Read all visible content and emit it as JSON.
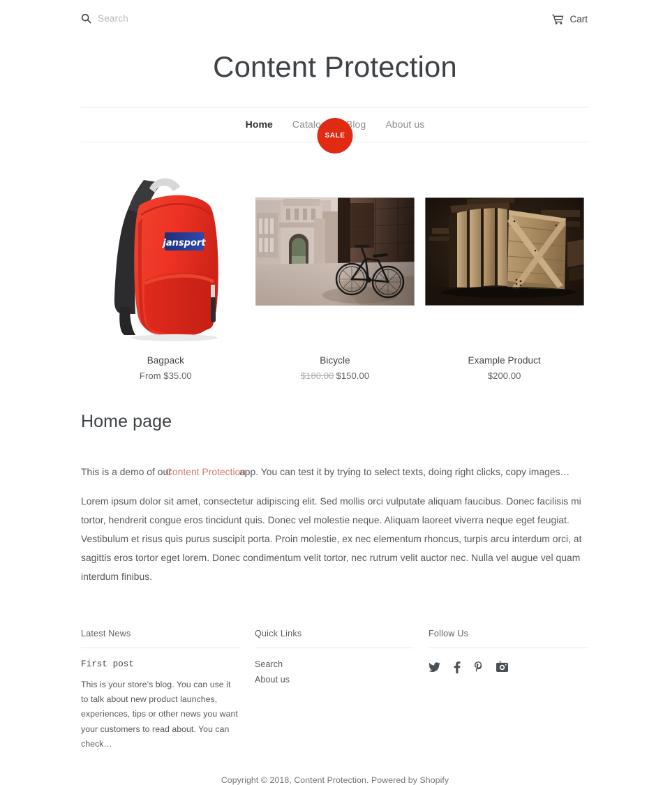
{
  "header": {
    "search": {
      "placeholder": "Search",
      "value": "",
      "icon": "search-icon"
    },
    "cart": {
      "label": "Cart",
      "icon": "cart-icon"
    },
    "site_title": "Content Protection"
  },
  "nav": {
    "items": [
      {
        "label": "Home",
        "active": true
      },
      {
        "label": "Catalog",
        "active": false
      },
      {
        "label": "Blog",
        "active": false
      },
      {
        "label": "About us",
        "active": false
      }
    ]
  },
  "products": [
    {
      "title": "Bagpack",
      "price": "From $35.00",
      "compare_price": "",
      "badge": "",
      "image": "red-jansport-backpack-on-white"
    },
    {
      "title": "Bicycle",
      "price": "$150.00",
      "compare_price": "$180.00",
      "badge": "SALE",
      "image": "bicycle-leaning-against-stone-building"
    },
    {
      "title": "Example Product",
      "price": "$200.00",
      "compare_price": "",
      "badge": "",
      "image": "stacked-wooden-crate-panels"
    }
  ],
  "article": {
    "heading": "Home page",
    "intro_before": "This is a demo of our",
    "intro_link": "Content Protection",
    "intro_after": "app. You can test it by trying to select texts, doing right clicks, copy images…",
    "body": "Lorem ipsum dolor sit amet, consectetur adipiscing elit. Sed mollis orci vulputate aliquam faucibus. Donec facilisis mi tortor, hendrerit congue eros tincidunt quis. Donec vel molestie neque. Aliquam laoreet viverra neque eget feugiat. Vestibulum et risus quis purus suscipit porta. Proin molestie, ex nec elementum rhoncus, turpis arcu interdum orci, at sagittis eros tortor eget lorem. Donec condimentum velit tortor, nec rutrum velit auctor nec. Nulla vel augue vel quam interdum finibus."
  },
  "footer": {
    "news": {
      "heading": "Latest News",
      "post_title": "First post",
      "post_excerpt": "This is your store’s blog. You can use it to talk about new product launches, experiences, tips or other news you want your customers to read about. You can check…"
    },
    "quick_links": {
      "heading": "Quick Links",
      "links": [
        {
          "label": "Search"
        },
        {
          "label": "About us"
        }
      ]
    },
    "follow": {
      "heading": "Follow Us",
      "socials": [
        {
          "name": "twitter-icon"
        },
        {
          "name": "facebook-icon"
        },
        {
          "name": "pinterest-icon"
        },
        {
          "name": "instagram-icon"
        }
      ]
    },
    "copyright": "Copyright © 2018, Content Protection. Powered by Shopify"
  },
  "colors": {
    "sale_badge": "#e02b12",
    "link": "#d07a68",
    "text": "#3d4246",
    "muted": "#8a8f94",
    "rule": "#e8e9eb"
  }
}
